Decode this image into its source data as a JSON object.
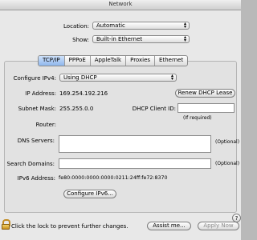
{
  "window": {
    "title": "Network"
  },
  "location": {
    "label": "Location:",
    "value": "Automatic"
  },
  "show": {
    "label": "Show:",
    "value": "Built-in Ethernet"
  },
  "tabs": [
    "TCP/IP",
    "PPPoE",
    "AppleTalk",
    "Proxies",
    "Ethernet"
  ],
  "configure_ipv4": {
    "label": "Configure IPv4:",
    "value": "Using DHCP"
  },
  "ip_address": {
    "label": "IP Address:",
    "value": "169.254.192.216"
  },
  "renew_button": "Renew DHCP Lease",
  "subnet_mask": {
    "label": "Subnet Mask:",
    "value": "255.255.0.0"
  },
  "dhcp_client_id": {
    "label": "DHCP Client ID:",
    "value": "",
    "hint": "(If required)"
  },
  "router": {
    "label": "Router:",
    "value": ""
  },
  "dns_servers": {
    "label": "DNS Servers:",
    "optional": "(Optional)"
  },
  "search_domains": {
    "label": "Search Domains:",
    "optional": "(Optional)"
  },
  "ipv6": {
    "label": "IPv6 Address:",
    "value": "fe80:0000:0000:0000:0211:24ff:fe72:8370"
  },
  "configure_ipv6_button": "Configure IPv6...",
  "help": "?",
  "footer": {
    "lock_text": "Click the lock to prevent further changes.",
    "assist_button": "Assist me...",
    "apply_button": "Apply Now"
  }
}
